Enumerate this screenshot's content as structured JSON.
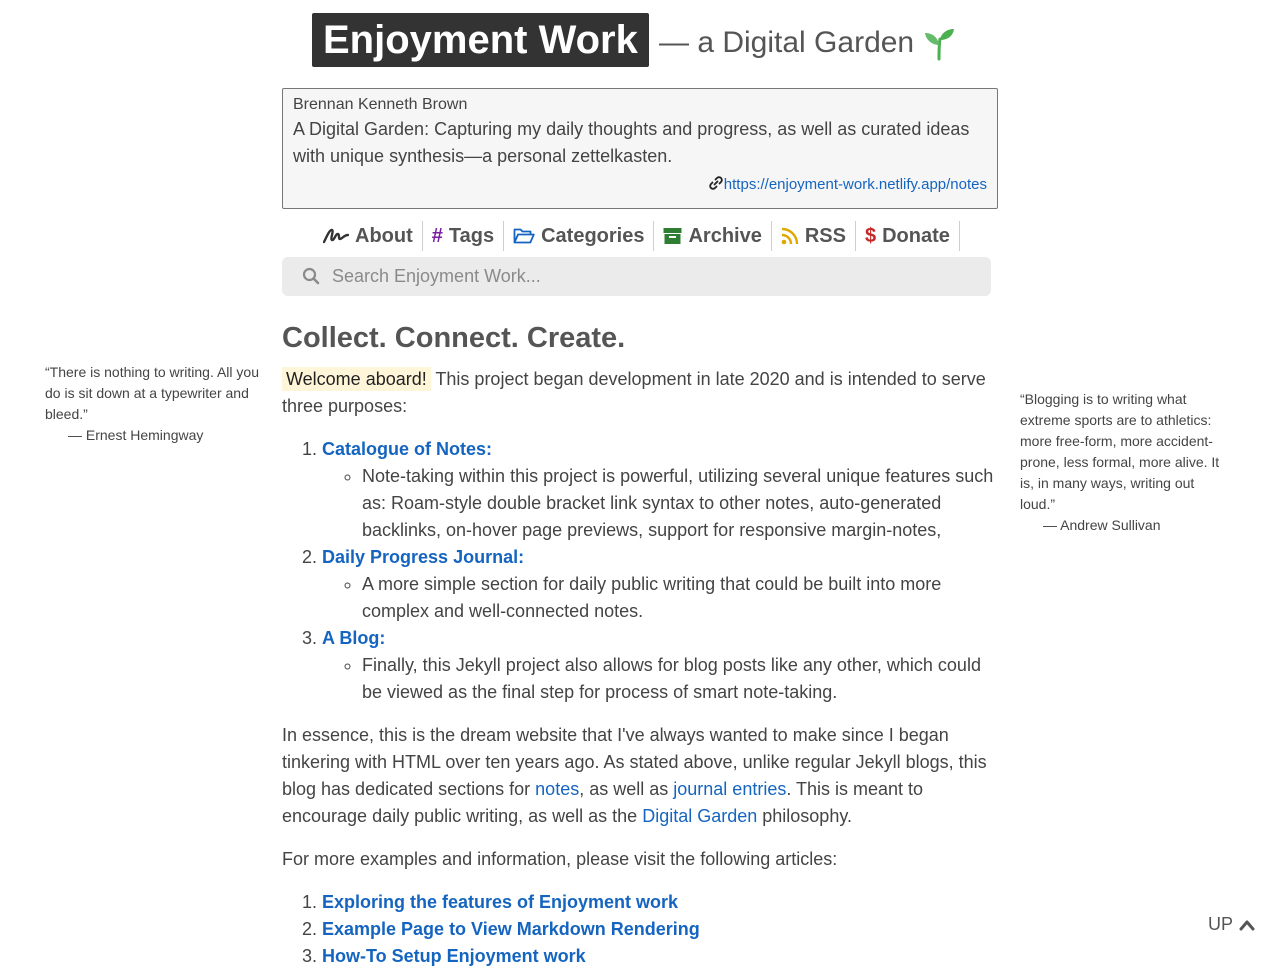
{
  "header": {
    "title": "Enjoyment Work",
    "subtitle": "— a Digital Garden"
  },
  "profile": {
    "name": "Brennan Kenneth Brown",
    "description": "A Digital Garden: Capturing my daily thoughts and progress, as well as curated ideas with unique synthesis—a personal zettelkasten.",
    "link_text": "https://enjoyment-work.netlify.app/notes"
  },
  "nav": {
    "items": [
      {
        "label": "About",
        "icon": "signature-icon"
      },
      {
        "label": "Tags",
        "icon": "hashtag-icon"
      },
      {
        "label": "Categories",
        "icon": "folder-open-icon"
      },
      {
        "label": "Archive",
        "icon": "archive-box-icon"
      },
      {
        "label": "RSS",
        "icon": "rss-icon"
      },
      {
        "label": "Donate",
        "icon": "dollar-icon"
      }
    ]
  },
  "search": {
    "placeholder": "Search Enjoyment Work..."
  },
  "main": {
    "heading": "Collect. Connect. Create.",
    "welcome": "Welcome aboard!",
    "intro": " This project began development in late 2020 and is intended to serve three purposes:",
    "purposes": [
      {
        "title": "Catalogue of Notes:",
        "detail": "Note-taking within this project is powerful, utilizing several unique features such as: Roam-style double bracket link syntax to other notes, auto-generated backlinks, on-hover page previews, support for responsive margin-notes,"
      },
      {
        "title": "Daily Progress Journal:",
        "detail": "A more simple section for daily public writing that could be built into more complex and well-connected notes."
      },
      {
        "title": "A Blog:",
        "detail": "Finally, this Jekyll project also allows for blog posts like any other, which could be viewed as the final step for process of smart note-taking."
      }
    ],
    "essence_1": "In essence, this is the dream website that I've always wanted to make since I began tinkering with HTML over ten years ago. As stated above, unlike regular Jekyll blogs, this blog has dedicated sections for ",
    "link_notes": "notes",
    "essence_2": ", as well as ",
    "link_journal": "journal entries",
    "essence_3": ". This is meant to encourage daily public writing, as well as the ",
    "link_garden": "Digital Garden",
    "essence_4": " philosophy.",
    "more_info": "For more examples and information, please visit the following articles:",
    "articles": [
      "Exploring the features of Enjoyment work",
      "Example Page to View Markdown Rendering",
      "How-To Setup Enjoyment work"
    ]
  },
  "quotes": {
    "left": {
      "text": "“There is nothing to writing. All you do is sit down at a typewriter and bleed.”",
      "author": "— Ernest Hemingway"
    },
    "right": {
      "text": "“Blogging is to writing what extreme sports are to athletics: more free-form, more accident-prone, less formal, more alive. It is, in many ways, writing out loud.”",
      "author": "— Andrew Sullivan"
    }
  },
  "up_button": {
    "label": "UP"
  },
  "colors": {
    "link": "#1565c0",
    "title_bg": "#333333",
    "highlight_bg": "#fff6d9",
    "tags_icon": "#7b1fa2",
    "categories_icon": "#1565c0",
    "archive_icon": "#2e7d32",
    "rss_icon": "#e0a800",
    "donate_icon": "#c62828",
    "sprout": "#4caf50"
  }
}
